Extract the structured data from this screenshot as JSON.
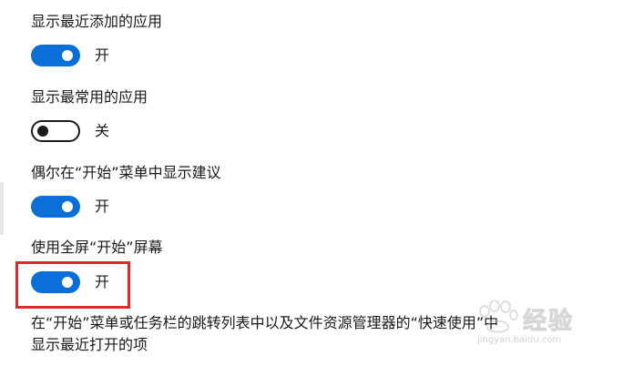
{
  "settings": [
    {
      "label": "显示最近添加的应用",
      "state": "on",
      "state_label": "开"
    },
    {
      "label": "显示最常用的应用",
      "state": "off",
      "state_label": "关"
    },
    {
      "label": "偶尔在“开始”菜单中显示建议",
      "state": "on",
      "state_label": "开"
    },
    {
      "label": "使用全屏“开始”屏幕",
      "state": "on",
      "state_label": "开"
    }
  ],
  "jump_list_setting": {
    "label_line1": "在“开始”菜单或任务栏的跳转列表中以及文件资源管理器的“快速使用”中",
    "label_line2": "显示最近打开的项"
  },
  "watermark": {
    "brand": "经验",
    "url": "jingyan.baidu.com"
  },
  "colors": {
    "toggle_on": "#0a6fd6",
    "toggle_off_border": "#1a1a1a",
    "highlight": "#e0292f"
  }
}
